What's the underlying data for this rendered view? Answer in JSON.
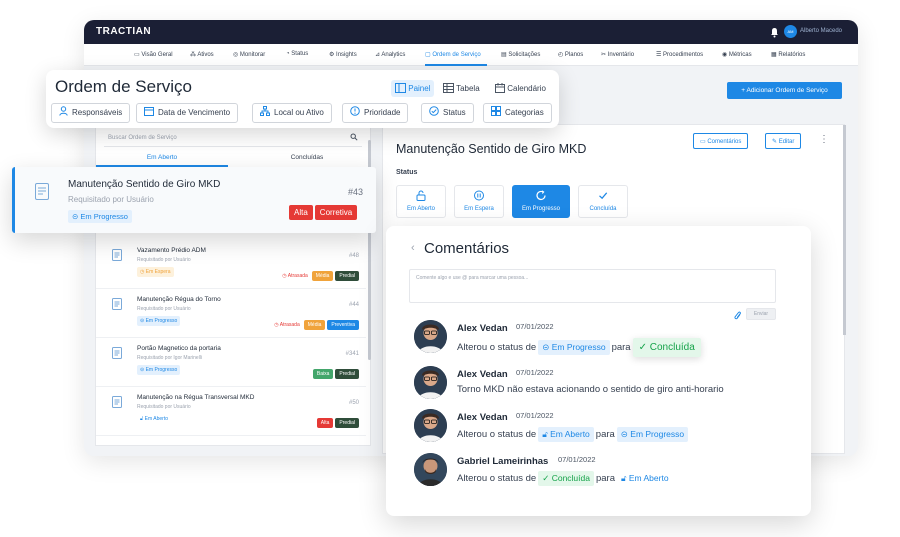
{
  "app": {
    "brand": "TRACTIAN",
    "user": "Alberto Macedo",
    "user_initials": "AM",
    "nav": [
      {
        "label": "Visão Geral",
        "icon": "monitor-icon"
      },
      {
        "label": "Ativos",
        "icon": "assets-icon"
      },
      {
        "label": "Monitorar",
        "icon": "gauge-icon"
      },
      {
        "label": "Status",
        "icon": "status-icon"
      },
      {
        "label": "Insights",
        "icon": "lightbulb-icon"
      },
      {
        "label": "Analytics",
        "icon": "chart-icon"
      },
      {
        "label": "Ordem de Serviço",
        "icon": "clipboard-icon",
        "active": true
      },
      {
        "label": "Solicitações",
        "icon": "request-icon"
      },
      {
        "label": "Planos",
        "icon": "plan-icon"
      },
      {
        "label": "Inventário",
        "icon": "tools-icon"
      },
      {
        "label": "Procedimentos",
        "icon": "list-icon"
      },
      {
        "label": "Métricas",
        "icon": "metrics-icon"
      },
      {
        "label": "Relatórios",
        "icon": "report-icon"
      }
    ],
    "add_button": "+ Adicionar Ordem de Serviço"
  },
  "header_card": {
    "title": "Ordem de Serviço",
    "views": [
      {
        "label": "Painel",
        "icon": "panel-icon",
        "active": true
      },
      {
        "label": "Tabela",
        "icon": "table-icon"
      },
      {
        "label": "Calendário",
        "icon": "calendar-icon"
      }
    ],
    "filters": [
      {
        "label": "Responsáveis",
        "icon": "user-icon"
      },
      {
        "label": "Data de Vencimento",
        "icon": "calendar-icon"
      },
      {
        "label": "Local ou Ativo",
        "icon": "hierarchy-icon"
      },
      {
        "label": "Prioridade",
        "icon": "priority-icon"
      },
      {
        "label": "Status",
        "icon": "check-circle-icon"
      },
      {
        "label": "Categorias",
        "icon": "categories-icon"
      }
    ]
  },
  "list": {
    "search_placeholder": "Buscar Ordem de Serviço",
    "tab_open": "Em Aberto",
    "tab_done": "Concluídas",
    "highlighted": {
      "title": "Manutenção Sentido de Giro MKD",
      "requested": "Requisitado por Usuário",
      "number": "#43",
      "status": "Em Progresso",
      "tags": [
        {
          "label": "Alta",
          "color": "#e53935"
        },
        {
          "label": "Corretiva",
          "color": "#e53935"
        }
      ]
    },
    "items": [
      {
        "title": "Vazamento Prédio ADM",
        "requested": "Requisitado por Usuário",
        "number": "#48",
        "status": "Em Espera",
        "status_kind": "wait",
        "late": "Atrasada",
        "tags": [
          {
            "label": "Média",
            "color": "#f0a33b"
          },
          {
            "label": "Predial",
            "color": "#2f4d3a"
          }
        ]
      },
      {
        "title": "Manutenção Régua do Torno",
        "requested": "Requisitado por Usuário",
        "number": "#44",
        "status": "Em Progresso",
        "status_kind": "progress",
        "late": "Atrasada",
        "tags": [
          {
            "label": "Média",
            "color": "#f0a33b"
          },
          {
            "label": "Preventiva",
            "color": "#1e88e5"
          }
        ]
      },
      {
        "title": "Portão Magnetico da portaria",
        "requested": "Requisitado por Igor Marinelli",
        "number": "#341",
        "status": "Em Progresso",
        "status_kind": "progress",
        "late": "",
        "tags": [
          {
            "label": "Baixa",
            "color": "#43a66b"
          },
          {
            "label": "Predial",
            "color": "#2f4d3a"
          }
        ]
      },
      {
        "title": "Manutenção na Régua Transversal MKD",
        "requested": "Requisitado por Usuário",
        "number": "#50",
        "status": "Em Aberto",
        "status_kind": "open",
        "late": "",
        "tags": [
          {
            "label": "Alta",
            "color": "#e53935"
          },
          {
            "label": "Predial",
            "color": "#2f4d3a"
          }
        ]
      }
    ]
  },
  "detail": {
    "title": "Manutenção Sentido de Giro MKD",
    "comments_button": "Comentários",
    "edit_button": "Editar",
    "status_label": "Status",
    "statuses": [
      {
        "label": "Em Aberto",
        "icon": "lock-icon"
      },
      {
        "label": "Em Espera",
        "icon": "pause-icon"
      },
      {
        "label": "Em Progresso",
        "icon": "progress-icon",
        "active": true
      },
      {
        "label": "Concluída",
        "icon": "check-icon"
      }
    ]
  },
  "comments": {
    "title": "Comentários",
    "placeholder": "Comente algo e use @ para marcar uma pessoa...",
    "send": "Enviar",
    "items": [
      {
        "author": "Alex Vedan",
        "date": "07/01/2022",
        "pre": "Alterou o status de",
        "from": "Em Progresso",
        "mid": "para",
        "to": "Concluída"
      },
      {
        "author": "Alex Vedan",
        "date": "07/01/2022",
        "text": "Torno MKD não estava acionando o sentido de giro anti-horario"
      },
      {
        "author": "Alex Vedan",
        "date": "07/01/2022",
        "pre": "Alterou o status de",
        "from": "Em Aberto",
        "mid": "para",
        "to": "Em Progresso"
      },
      {
        "author": "Gabriel Lameirinhas",
        "date": "07/01/2022",
        "pre": "Alterou o status de",
        "from": "Concluída",
        "mid": "para",
        "to": "Em Aberto"
      }
    ]
  },
  "colors": {
    "accent": "#1e88e5",
    "topbar": "#1b1f35",
    "success": "#16a34a",
    "danger": "#e53935"
  }
}
